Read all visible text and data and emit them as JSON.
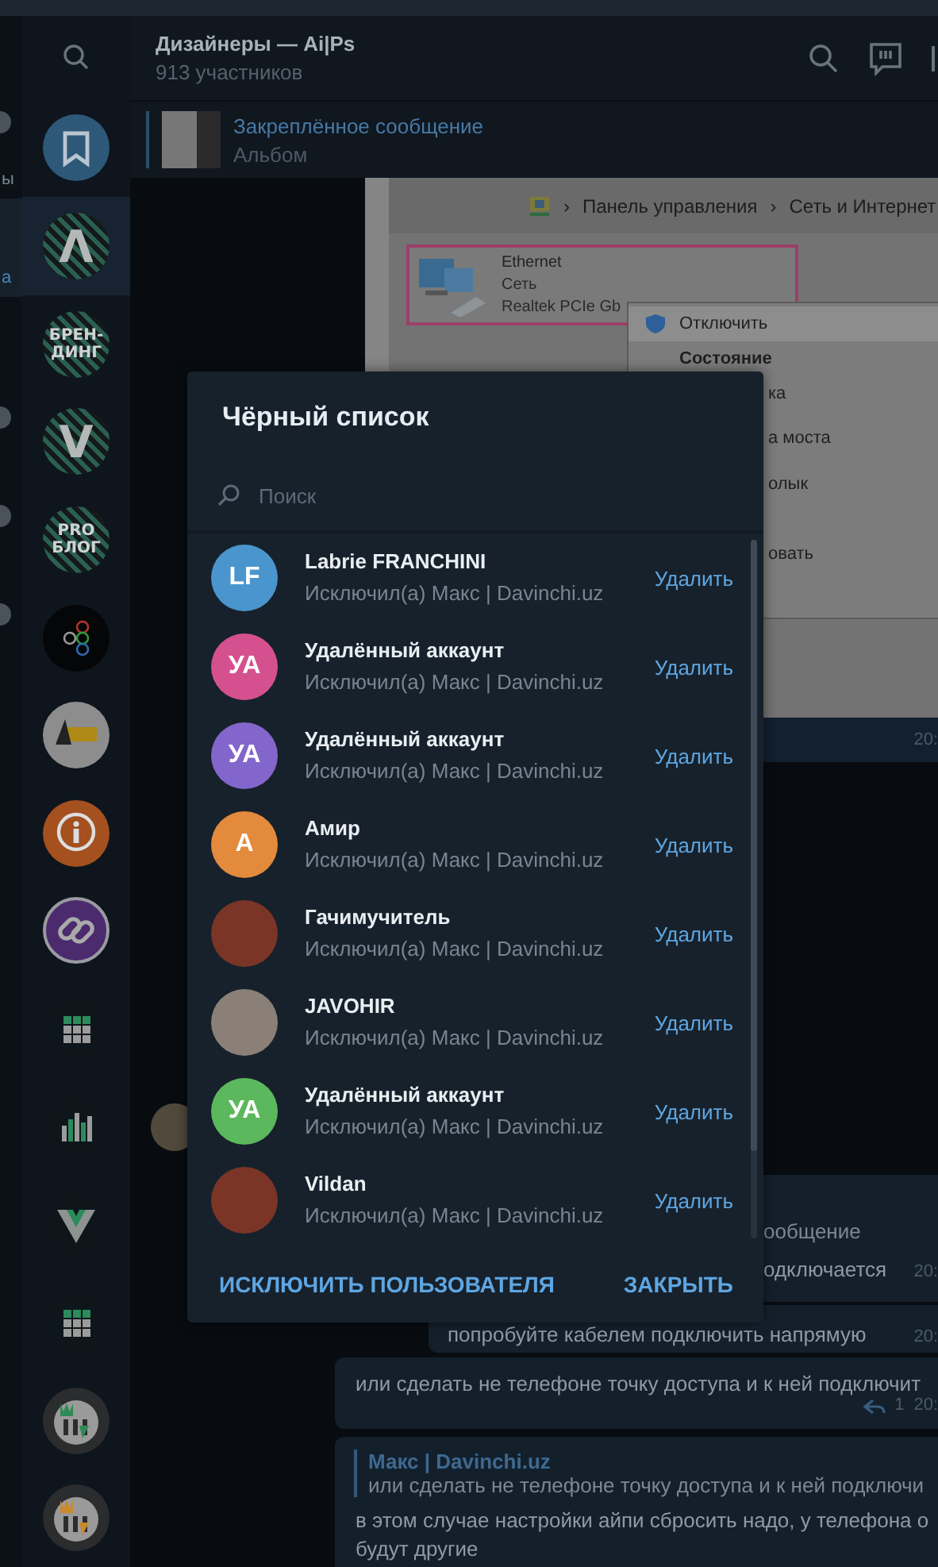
{
  "chat_list_edge": [
    {
      "badge": true,
      "label": "ы",
      "selected": false
    },
    {
      "badge": false,
      "label": "а",
      "selected": true
    },
    {
      "badge": false,
      "selected": false
    },
    {
      "badge": true,
      "selected": false
    },
    {
      "badge": true,
      "selected": false
    },
    {
      "badge": true,
      "selected": false
    }
  ],
  "folders": [
    {
      "kind": "bookmark",
      "selected": false
    },
    {
      "kind": "striped-letter",
      "letter": "Λ",
      "selected": true
    },
    {
      "kind": "striped-text",
      "lines": [
        "БРЕН-",
        "ДИНГ"
      ],
      "selected": false
    },
    {
      "kind": "striped-letter",
      "letter": "V",
      "selected": false
    },
    {
      "kind": "striped-text",
      "lines": [
        "PRO",
        "БЛОГ"
      ],
      "selected": false
    },
    {
      "kind": "rings",
      "selected": false
    },
    {
      "kind": "arena",
      "selected": false
    },
    {
      "kind": "info",
      "selected": false
    },
    {
      "kind": "link",
      "selected": false
    },
    {
      "kind": "grid",
      "selected": false
    },
    {
      "kind": "bars",
      "selected": false
    },
    {
      "kind": "vee",
      "selected": false
    },
    {
      "kind": "grid",
      "selected": false
    },
    {
      "kind": "castle",
      "color": "#2e8a55",
      "selected": false
    },
    {
      "kind": "castle",
      "color": "#c98a2a",
      "selected": false
    }
  ],
  "chat": {
    "title": "Дизайнеры — Ai|Ps",
    "subtitle": "913 участников"
  },
  "pinned": {
    "title": "Закреплённое сообщение",
    "subtitle": "Альбом"
  },
  "screenshot_message": {
    "breadcrumb": [
      {
        "separator": "›",
        "label": "Панель управления"
      },
      {
        "separator": "›",
        "label": "Сеть и Интернет"
      }
    ],
    "adapter": {
      "name": "Ethernet",
      "status": "Сеть",
      "device": "Realtek PCIe Gb"
    },
    "context_menu": [
      {
        "label": "Отключить",
        "hovered": true,
        "default": false
      },
      {
        "label": "Состояние",
        "hovered": false,
        "default": true
      },
      {
        "label": "ка",
        "hovered": false,
        "default": false
      },
      {
        "label": "а моста",
        "hovered": false,
        "default": false
      },
      {
        "label": "олык",
        "hovered": false,
        "default": false
      },
      {
        "label": "овать",
        "hovered": false,
        "default": false
      }
    ],
    "time": "20:"
  },
  "messages": [
    {
      "kind": "partial",
      "lines": [
        "ообщение",
        "одключается"
      ],
      "time": "20:"
    },
    {
      "kind": "text",
      "text": "попробуйте кабелем подключить напрямую",
      "time": "20:"
    },
    {
      "kind": "text",
      "text": "или сделать не телефоне точку доступа и к ней подключит",
      "replies": "1",
      "time": "20:"
    },
    {
      "kind": "reply",
      "quote_author": "Макс | Davinchi.uz",
      "quote_text": "или сделать не телефоне точку доступа и к ней подключи",
      "lines": [
        "в этом случае настройки айпи сбросить надо, у телефона о",
        "будут другие"
      ]
    }
  ],
  "dialog": {
    "title": "Чёрный список",
    "search_placeholder": "Поиск",
    "items": [
      {
        "name": "Labrie FRANCHINI",
        "subtitle": "Исключил(а) Макс | Davinchi.uz",
        "action": "Удалить",
        "avatar": {
          "kind": "initials",
          "initials": "LF",
          "color": "#4a95cd"
        }
      },
      {
        "name": "Удалённый аккаунт",
        "subtitle": "Исключил(а) Макс | Davinchi.uz",
        "action": "Удалить",
        "avatar": {
          "kind": "initials",
          "initials": "УА",
          "color": "#d5508e"
        }
      },
      {
        "name": "Удалённый аккаунт",
        "subtitle": "Исключил(а) Макс | Davinchi.uz",
        "action": "Удалить",
        "avatar": {
          "kind": "initials",
          "initials": "УА",
          "color": "#8366cc"
        }
      },
      {
        "name": "Амир",
        "subtitle": "Исключил(а) Макс | Davinchi.uz",
        "action": "Удалить",
        "avatar": {
          "kind": "initials",
          "initials": "А",
          "color": "#e38a3c"
        }
      },
      {
        "name": "Гачимучитель",
        "subtitle": "Исключил(а) Макс | Davinchi.uz",
        "action": "Удалить",
        "avatar": {
          "kind": "photo"
        }
      },
      {
        "name": "JAVOHIR",
        "subtitle": "Исключил(а) Макс | Davinchi.uz",
        "action": "Удалить",
        "avatar": {
          "kind": "photo"
        }
      },
      {
        "name": "Удалённый аккаунт",
        "subtitle": "Исключил(а) Макс | Davinchi.uz",
        "action": "Удалить",
        "avatar": {
          "kind": "initials",
          "initials": "УА",
          "color": "#5cb85c"
        }
      },
      {
        "name": "Vildan",
        "subtitle": "Исключил(а) Макс | Davinchi.uz",
        "action": "Удалить",
        "avatar": {
          "kind": "photo"
        }
      }
    ],
    "buttons": [
      "ИСКЛЮЧИТЬ ПОЛЬЗОВАТЕЛЯ",
      "ЗАКРЫТЬ"
    ]
  }
}
